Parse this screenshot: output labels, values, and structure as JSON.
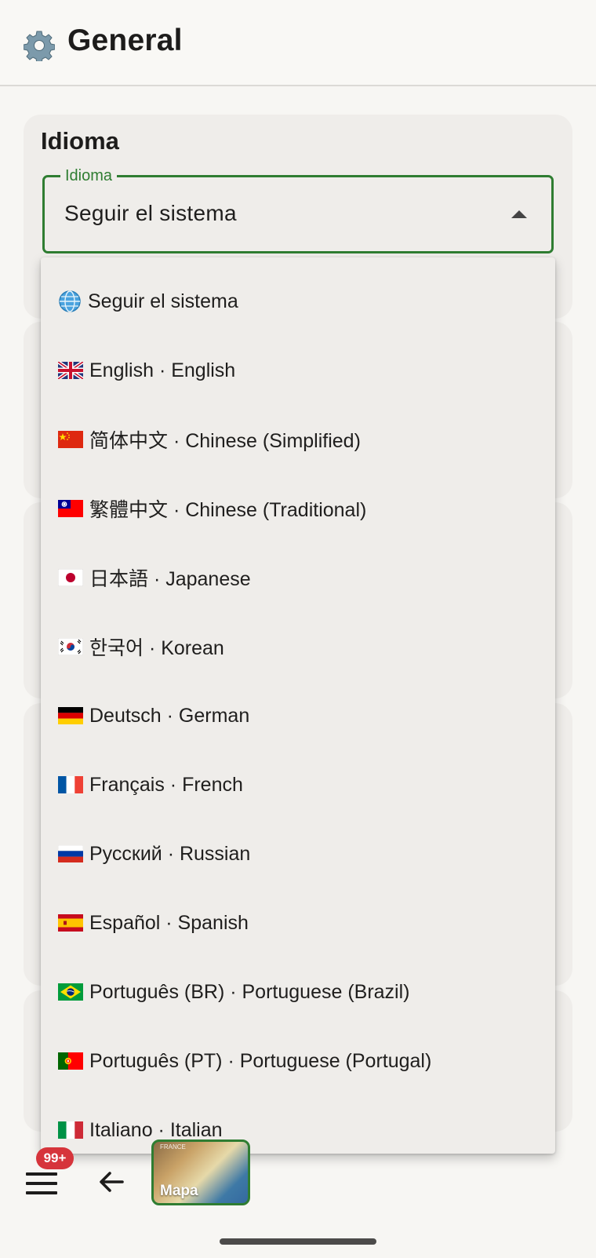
{
  "header": {
    "title": "General",
    "icon": "gear-icon"
  },
  "language_card": {
    "title": "Idioma",
    "select": {
      "legend": "Idioma",
      "value": "Seguir el sistema",
      "accent_color": "#2f7d32"
    }
  },
  "language_menu": {
    "items": [
      {
        "flag": "globe",
        "label": "Seguir el sistema"
      },
      {
        "flag": "uk",
        "label": "English · English"
      },
      {
        "flag": "cn",
        "label": "简体中文 · Chinese (Simplified)"
      },
      {
        "flag": "tw",
        "label": "繁體中文 · Chinese (Traditional)"
      },
      {
        "flag": "jp",
        "label": "日本語 · Japanese"
      },
      {
        "flag": "kr",
        "label": "한국어 · Korean"
      },
      {
        "flag": "de",
        "label": "Deutsch · German"
      },
      {
        "flag": "fr",
        "label": "Français · French"
      },
      {
        "flag": "ru",
        "label": "Русский · Russian"
      },
      {
        "flag": "es",
        "label": "Español · Spanish"
      },
      {
        "flag": "br",
        "label": "Português (BR) · Portuguese (Brazil)"
      },
      {
        "flag": "pt",
        "label": "Português (PT) · Portuguese (Portugal)"
      },
      {
        "flag": "it",
        "label": "Italiano · Italian"
      }
    ]
  },
  "bottom_bar": {
    "badge": "99+",
    "map_label": "Mapa",
    "map_sublabel": "FRANCE"
  }
}
